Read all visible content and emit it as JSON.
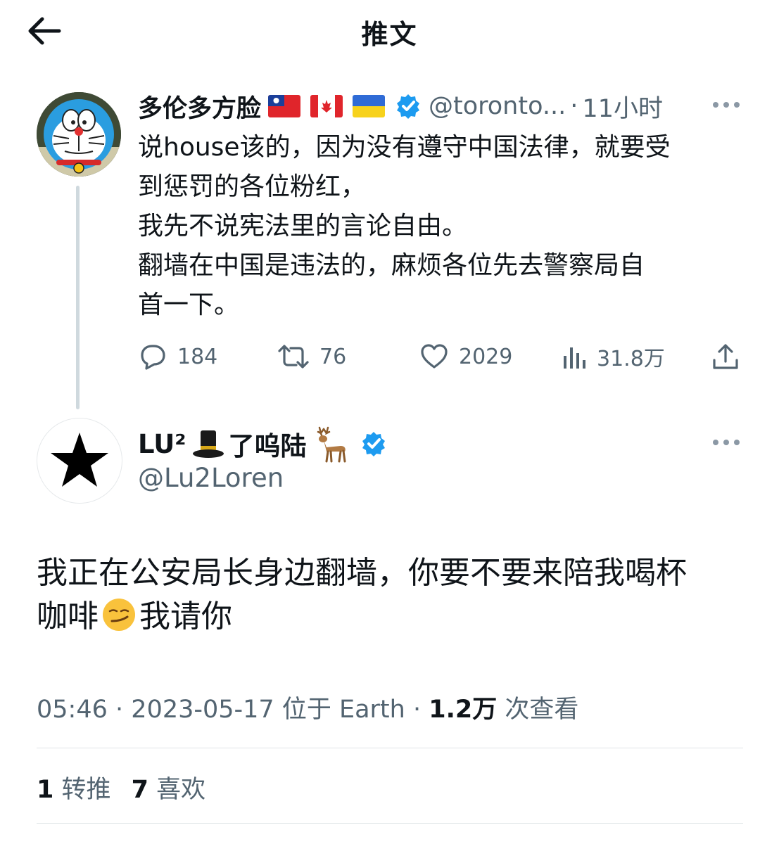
{
  "header": {
    "title": "推文",
    "back_icon": "arrow-left-icon"
  },
  "parent_tweet": {
    "author_name": "多伦多方脸",
    "flags": [
      "taiwan-flag-icon",
      "canada-flag-icon",
      "ukraine-flag-icon"
    ],
    "verified": true,
    "handle": "@toronto...",
    "separator": "·",
    "time": "11小时",
    "text": "说house该的，因为没有遵守中国法律，就要受\n到惩罚的各位粉红，\n我先不说宪法里的言论自由。\n翻墙在中国是违法的，麻烦各位先去警察局自\n首一下。",
    "actions": {
      "replies": "184",
      "retweets": "76",
      "likes": "2029",
      "views": "31.8万"
    }
  },
  "tweet": {
    "author_name": "LU²",
    "author_name_suffix": "了呜陆",
    "name_emojis": [
      "top-hat-icon",
      "deer-icon"
    ],
    "verified": true,
    "handle": "@Lu2Loren",
    "text_before_emoji": "我正在公安局长身边翻墙，你要不要来陪我喝杯\n咖啡",
    "text_emoji": "smirking-face-icon",
    "text_after_emoji": "我请你",
    "time": "05:46",
    "date": "2023-05-17",
    "location": "位于 Earth",
    "views_count": "1.2万",
    "views_label": "次查看",
    "retweet_count": "1",
    "retweet_label": "转推",
    "like_count": "7",
    "like_label": "喜欢"
  },
  "colors": {
    "verified": "#1d9bf0",
    "text_primary": "#0f1419",
    "text_secondary": "#536471",
    "divider": "#dfe4e7"
  }
}
